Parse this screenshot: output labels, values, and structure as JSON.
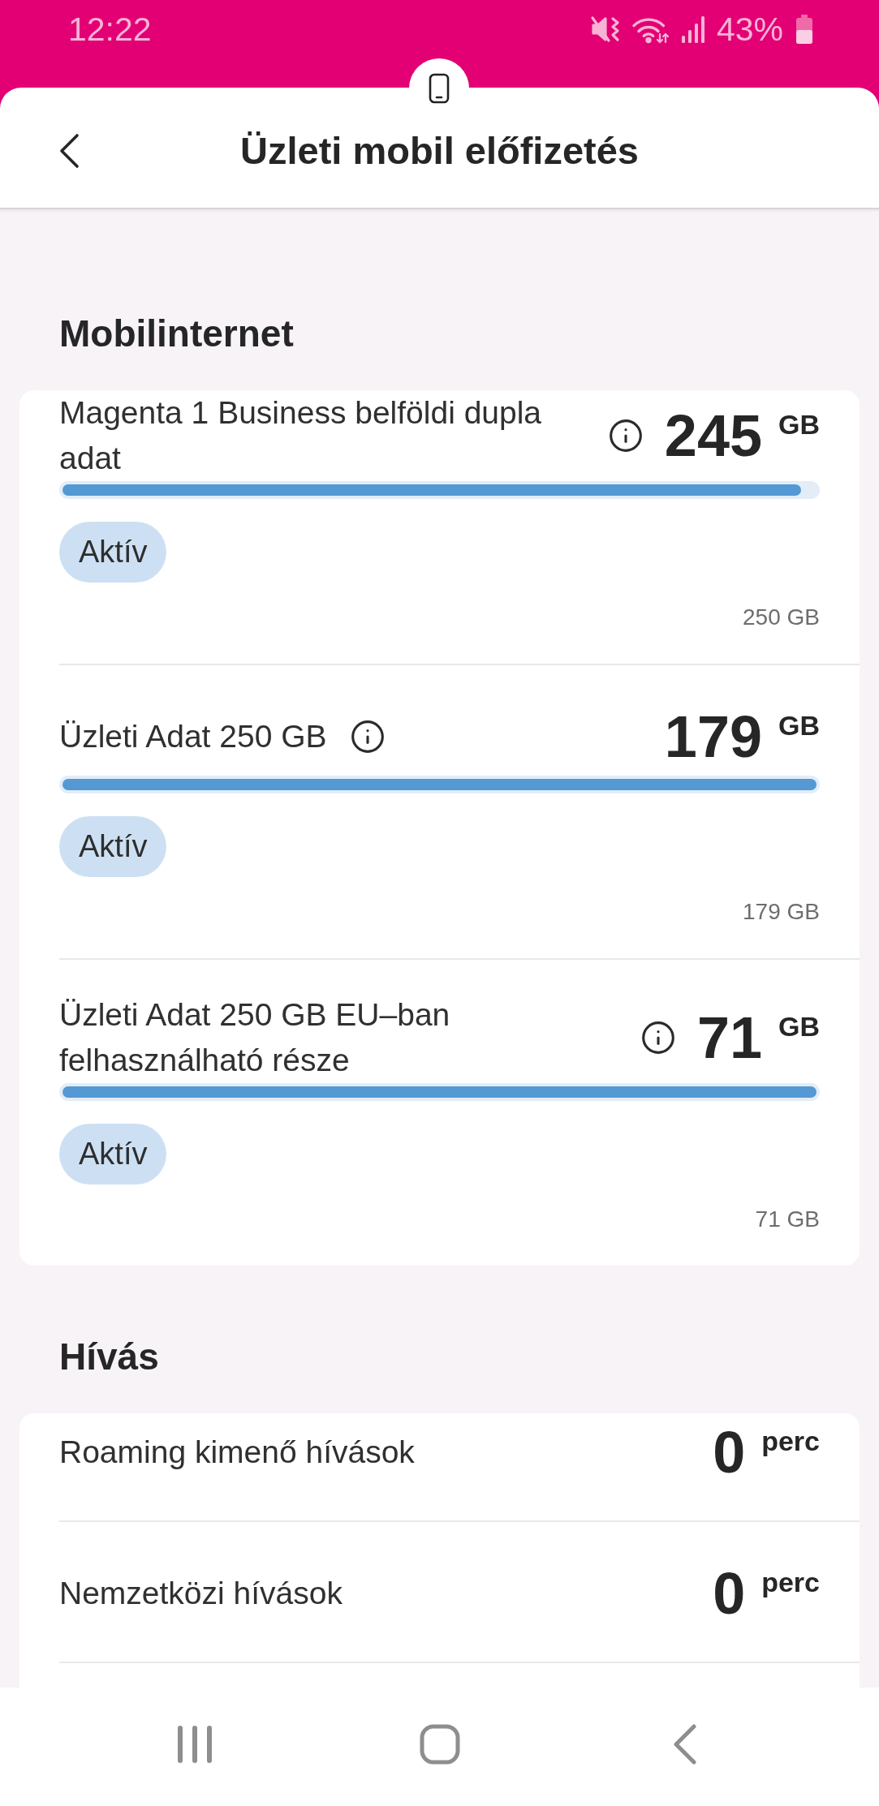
{
  "status_bar": {
    "time": "12:22",
    "battery_text": "43%"
  },
  "header": {
    "title": "Üzleti mobil előfizetés"
  },
  "sections": [
    {
      "title": "Mobilinternet",
      "kind": "data",
      "items": [
        {
          "name": "Magenta 1 Business belföldi dupla adat",
          "amount": "245",
          "unit": "GB",
          "level": 0.98,
          "status": "Aktív",
          "quota": "250 GB"
        },
        {
          "name": "Üzleti Adat 250 GB",
          "amount": "179",
          "unit": "GB",
          "level": 1,
          "status": "Aktív",
          "quota": "179 GB"
        },
        {
          "name": "Üzleti Adat 250 GB EU–ban felhasználható része",
          "amount": "71",
          "unit": "GB",
          "level": 1,
          "status": "Aktív",
          "quota": "71 GB"
        }
      ]
    },
    {
      "title": "Hívás",
      "kind": "calls",
      "items": [
        {
          "name": "Roaming kimenő hívások",
          "amount": "0",
          "unit": "perc"
        },
        {
          "name": "Nemzetközi hívások",
          "amount": "0",
          "unit": "perc"
        }
      ]
    }
  ]
}
